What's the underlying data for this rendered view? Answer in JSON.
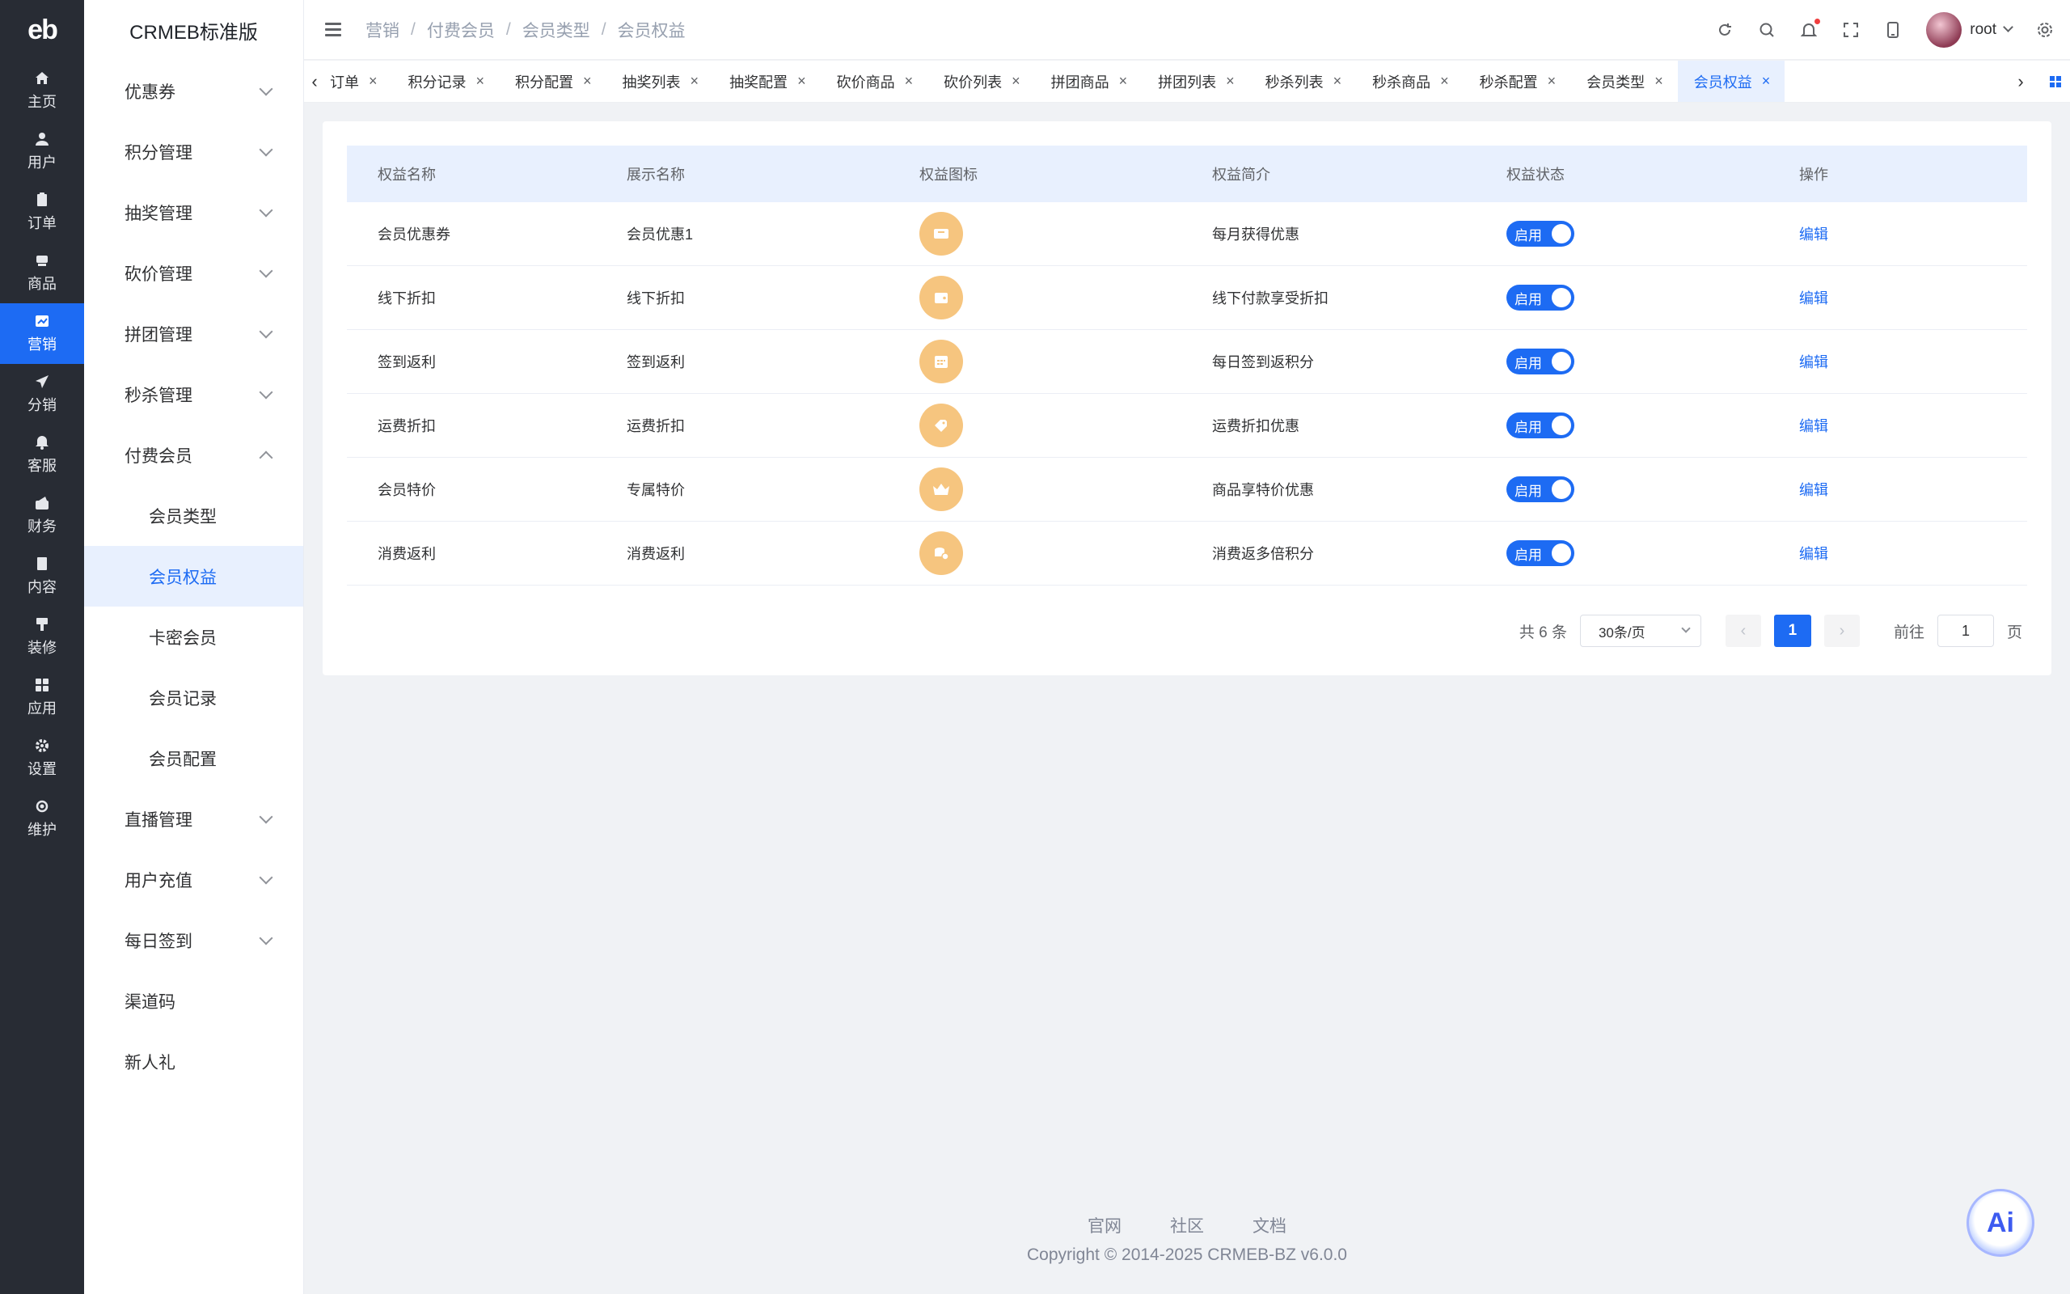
{
  "rail": {
    "logo": "eb",
    "items": [
      {
        "label": "主页",
        "icon": "home-icon"
      },
      {
        "label": "用户",
        "icon": "user-icon"
      },
      {
        "label": "订单",
        "icon": "order-icon"
      },
      {
        "label": "商品",
        "icon": "product-icon"
      },
      {
        "label": "营销",
        "icon": "marketing-icon"
      },
      {
        "label": "分销",
        "icon": "distribution-icon"
      },
      {
        "label": "客服",
        "icon": "service-icon"
      },
      {
        "label": "财务",
        "icon": "finance-icon"
      },
      {
        "label": "内容",
        "icon": "content-icon"
      },
      {
        "label": "装修",
        "icon": "decoration-icon"
      },
      {
        "label": "应用",
        "icon": "apps-icon"
      },
      {
        "label": "设置",
        "icon": "settings-icon"
      },
      {
        "label": "维护",
        "icon": "maintenance-icon"
      }
    ],
    "active_index": 4
  },
  "submenu": {
    "brand": "CRMEB标准版",
    "groups_top": [
      "优惠券",
      "积分管理",
      "抽奖管理",
      "砍价管理",
      "拼团管理",
      "秒杀管理"
    ],
    "open_group": "付费会员",
    "open_children": [
      "会员类型",
      "会员权益",
      "卡密会员",
      "会员记录",
      "会员配置"
    ],
    "active_child": "会员权益",
    "groups_bottom": [
      "直播管理",
      "用户充值",
      "每日签到"
    ],
    "plain_items": [
      "渠道码",
      "新人礼"
    ]
  },
  "header": {
    "breadcrumbs": [
      "营销",
      "付费会员",
      "会员类型",
      "会员权益"
    ],
    "username": "root"
  },
  "tabs": {
    "items": [
      "订单",
      "积分记录",
      "积分配置",
      "抽奖列表",
      "抽奖配置",
      "砍价商品",
      "砍价列表",
      "拼团商品",
      "拼团列表",
      "秒杀列表",
      "秒杀商品",
      "秒杀配置",
      "会员类型",
      "会员权益"
    ],
    "active": "会员权益"
  },
  "table": {
    "columns": [
      "权益名称",
      "展示名称",
      "权益图标",
      "权益简介",
      "权益状态",
      "操作"
    ],
    "rows": [
      {
        "name": "会员优惠券",
        "display": "会员优惠1",
        "icon": "coupon-icon",
        "desc": "每月获得优惠",
        "status": "启用",
        "action": "编辑"
      },
      {
        "name": "线下折扣",
        "display": "线下折扣",
        "icon": "wallet-icon",
        "desc": "线下付款享受折扣",
        "status": "启用",
        "action": "编辑"
      },
      {
        "name": "签到返利",
        "display": "签到返利",
        "icon": "calendar-icon",
        "desc": "每日签到返积分",
        "status": "启用",
        "action": "编辑"
      },
      {
        "name": "运费折扣",
        "display": "运费折扣",
        "icon": "shipping-tag-icon",
        "desc": "运费折扣优惠",
        "status": "启用",
        "action": "编辑"
      },
      {
        "name": "会员特价",
        "display": "专属特价",
        "icon": "crown-icon",
        "desc": "商品享特价优惠",
        "status": "启用",
        "action": "编辑"
      },
      {
        "name": "消费返利",
        "display": "消费返利",
        "icon": "coins-icon",
        "desc": "消费返多倍积分",
        "status": "启用",
        "action": "编辑"
      }
    ]
  },
  "pagination": {
    "total_text": "共 6 条",
    "page_size": "30条/页",
    "current_page": "1",
    "goto_prefix": "前往",
    "goto_value": "1",
    "goto_suffix": "页"
  },
  "footer": {
    "links": [
      "官网",
      "社区",
      "文档"
    ],
    "copyright": "Copyright © 2014-2025 CRMEB-BZ v6.0.0"
  },
  "ai_button": "Ai",
  "colors": {
    "primary": "#1d6bf3",
    "rail_bg": "#282c34",
    "icon_badge": "#f6c57f"
  }
}
